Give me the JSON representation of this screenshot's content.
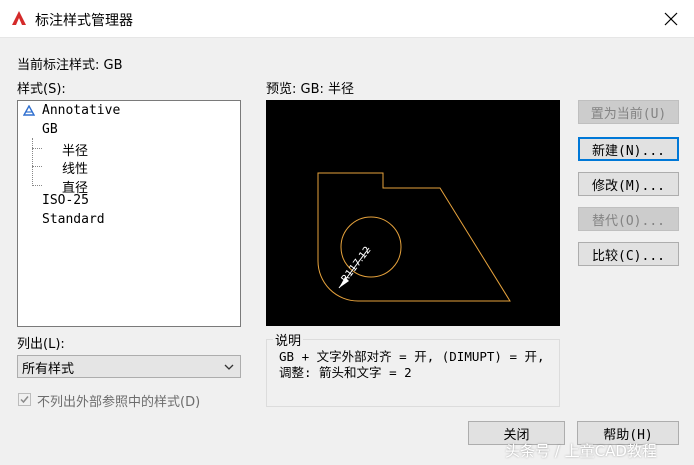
{
  "window": {
    "title": "标注样式管理器"
  },
  "current_style": {
    "label": "当前标注样式: GB"
  },
  "styles": {
    "label": "样式(S):",
    "items": [
      {
        "name": "Annotative",
        "annotative": true
      },
      {
        "name": "GB"
      },
      {
        "name": "半径",
        "child": true
      },
      {
        "name": "线性",
        "child": true
      },
      {
        "name": "直径",
        "child": true
      },
      {
        "name": "ISO-25"
      },
      {
        "name": "Standard"
      }
    ]
  },
  "list": {
    "label": "列出(L):",
    "selected": "所有样式"
  },
  "exclude_xref": {
    "label": "不列出外部参照中的样式(D)",
    "checked": true,
    "enabled": false
  },
  "preview": {
    "label": "预览: GB: 半径",
    "dimension_text": "R117.12",
    "colors": {
      "background": "#000000",
      "geometry": "#e6a23c",
      "dimension": "#ffffff"
    }
  },
  "description": {
    "label": "说明",
    "text": "GB + 文字外部对齐 = 开, (DIMUPT) = 开, 调整: 箭头和文字 = 2"
  },
  "buttons": {
    "set_current": "置为当前(U)",
    "new": "新建(N)...",
    "modify": "修改(M)...",
    "override": "替代(O)...",
    "compare": "比较(C)...",
    "close": "关闭",
    "help": "帮助(H)"
  },
  "watermark": {
    "text": "头条号 / 上童CAD教程"
  }
}
